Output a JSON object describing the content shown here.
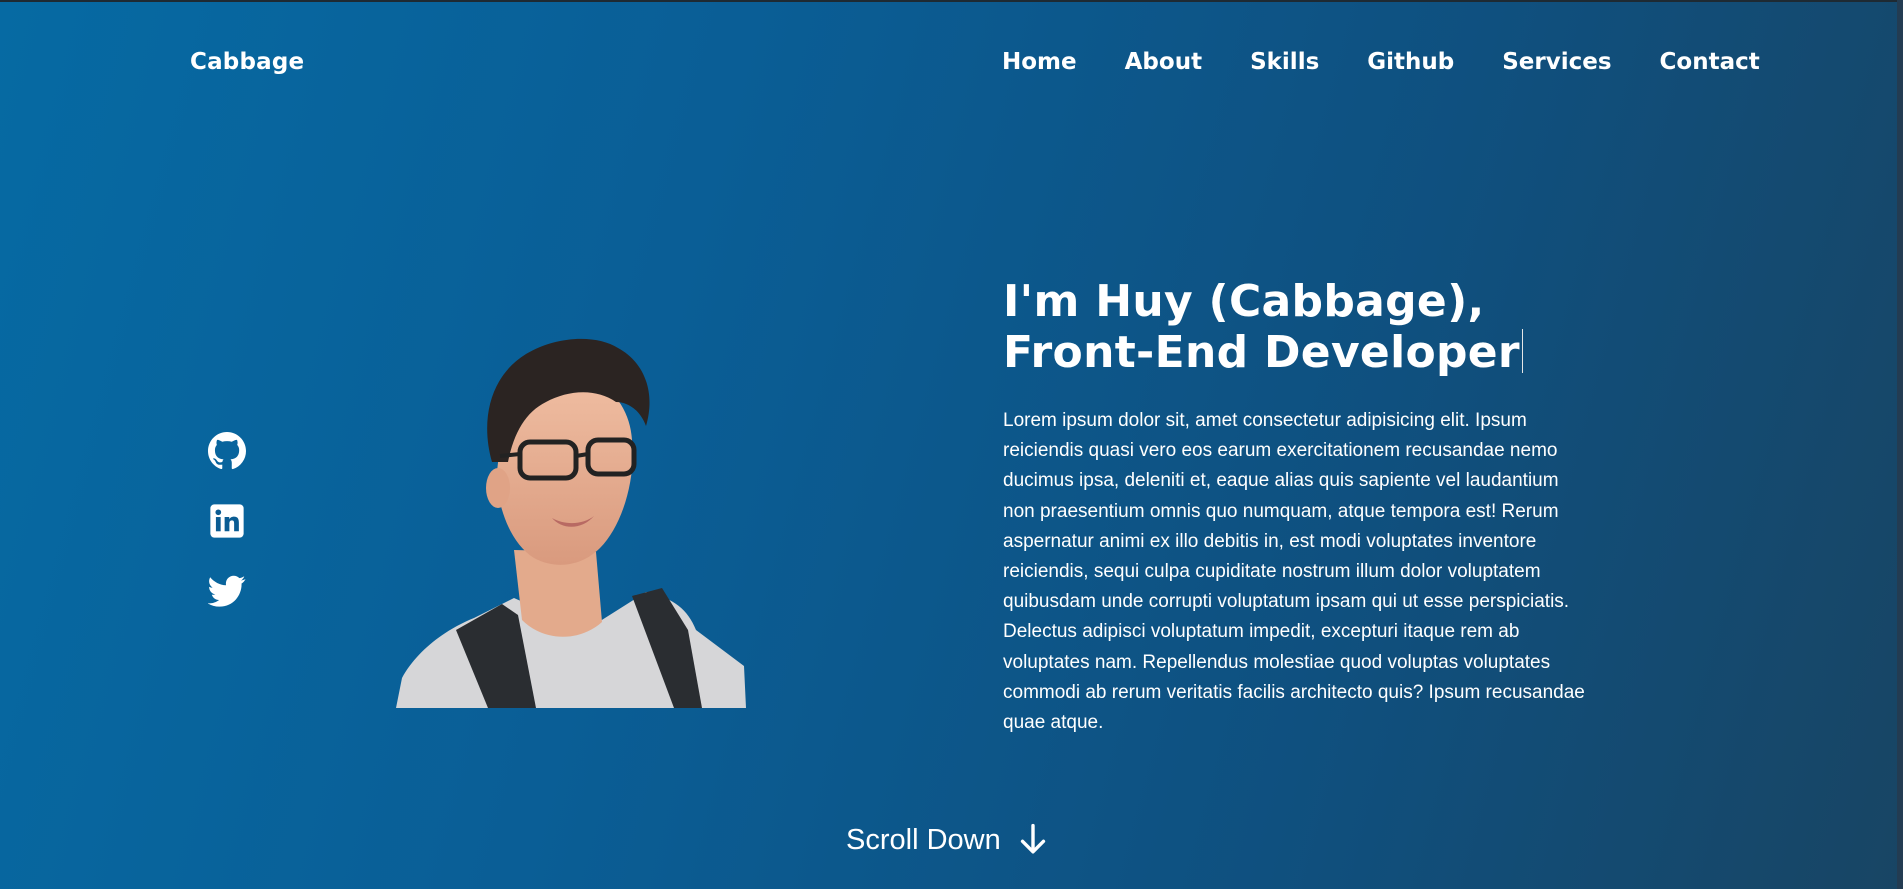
{
  "header": {
    "logo": "Cabbage",
    "nav": [
      {
        "label": "Home"
      },
      {
        "label": "About"
      },
      {
        "label": "Skills"
      },
      {
        "label": "Github"
      },
      {
        "label": "Services"
      },
      {
        "label": "Contact"
      }
    ]
  },
  "socials": [
    {
      "icon": "github-icon"
    },
    {
      "icon": "linkedin-icon"
    },
    {
      "icon": "twitter-icon"
    }
  ],
  "hero": {
    "title": "I'm Huy (Cabbage), Front-End Developer",
    "description": "Lorem ipsum dolor sit, amet consectetur adipisicing elit. Ipsum reiciendis quasi vero eos earum exercitationem recusandae nemo ducimus ipsa, deleniti et, eaque alias quis sapiente vel laudantium non praesentium omnis quo numquam, atque tempora est! Rerum aspernatur animi ex illo debitis in, est modi voluptates inventore reiciendis, sequi culpa cupiditate nostrum illum dolor voluptatem quibusdam unde corrupti voluptatum ipsam qui ut esse perspiciatis. Delectus adipisci voluptatum impedit, excepturi itaque rem ab voluptates nam. Repellendus molestiae quod voluptas voluptates commodi ab rerum veritatis facilis architecto quis? Ipsum recusandae quae atque.",
    "scroll_label": "Scroll Down"
  },
  "colors": {
    "background_start": "#066aa3",
    "background_end": "#184564",
    "text": "#ffffff"
  }
}
